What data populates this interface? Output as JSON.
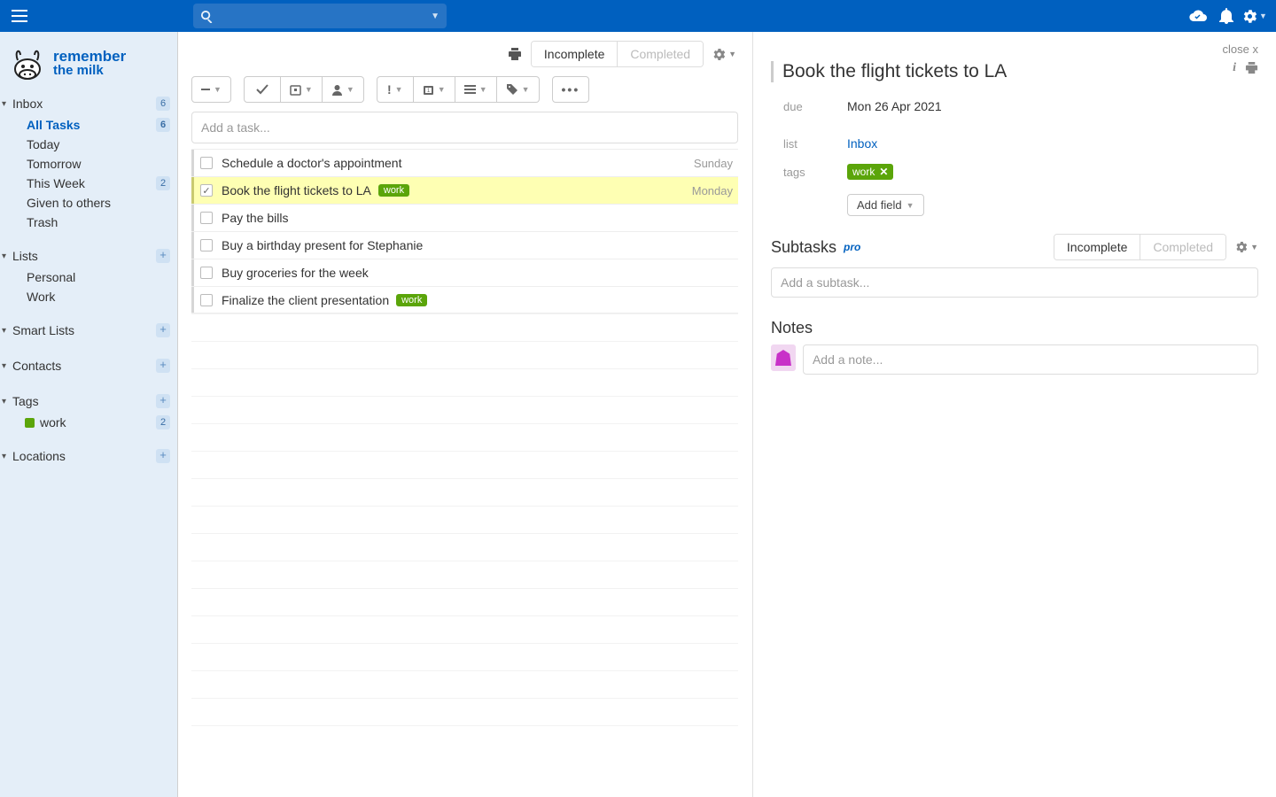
{
  "topbar": {
    "search_placeholder": ""
  },
  "sidebar": {
    "logo_line1": "remember",
    "logo_line2": "the milk",
    "inbox": {
      "label": "Inbox",
      "count": "6"
    },
    "views": [
      {
        "label": "All Tasks",
        "count": "6",
        "active": true
      },
      {
        "label": "Today"
      },
      {
        "label": "Tomorrow"
      },
      {
        "label": "This Week",
        "count": "2"
      },
      {
        "label": "Given to others"
      },
      {
        "label": "Trash"
      }
    ],
    "lists_header": "Lists",
    "lists": [
      {
        "label": "Personal"
      },
      {
        "label": "Work"
      }
    ],
    "smartlists_header": "Smart Lists",
    "contacts_header": "Contacts",
    "tags_header": "Tags",
    "tags": [
      {
        "label": "work",
        "count": "2"
      }
    ],
    "locations_header": "Locations"
  },
  "list": {
    "tab_incomplete": "Incomplete",
    "tab_completed": "Completed",
    "add_placeholder": "Add a task...",
    "tasks": [
      {
        "title": "Schedule a doctor's appointment",
        "due": "Sunday"
      },
      {
        "title": "Book the flight tickets to LA",
        "due": "Monday",
        "tag": "work",
        "selected": true,
        "checked": true
      },
      {
        "title": "Pay the bills"
      },
      {
        "title": "Buy a birthday present for Stephanie"
      },
      {
        "title": "Buy groceries for the week"
      },
      {
        "title": "Finalize the client presentation",
        "tag": "work"
      }
    ]
  },
  "detail": {
    "close": "close x",
    "title": "Book the flight tickets to LA",
    "due_label": "due",
    "due_value": "Mon 26 Apr 2021",
    "list_label": "list",
    "list_value": "Inbox",
    "tags_label": "tags",
    "tag_value": "work",
    "add_field": "Add field",
    "subtasks_header": "Subtasks",
    "pro": "pro",
    "sub_tab_incomplete": "Incomplete",
    "sub_tab_completed": "Completed",
    "sub_placeholder": "Add a subtask...",
    "notes_header": "Notes",
    "note_placeholder": "Add a note..."
  }
}
